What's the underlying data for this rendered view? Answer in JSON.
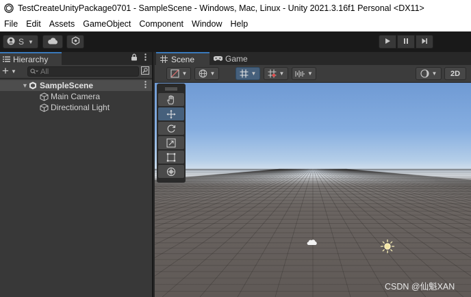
{
  "window": {
    "title": "TestCreateUnityPackage0701 - SampleScene - Windows, Mac, Linux - Unity 2021.3.16f1 Personal <DX11>"
  },
  "menu": {
    "items": [
      "File",
      "Edit",
      "Assets",
      "GameObject",
      "Component",
      "Window",
      "Help"
    ]
  },
  "toolbar": {
    "account_label": "S"
  },
  "hierarchy": {
    "tab_label": "Hierarchy",
    "search_placeholder": "All",
    "add_label": "+",
    "scene_name": "SampleScene",
    "items": [
      {
        "label": "Main Camera"
      },
      {
        "label": "Directional Light"
      }
    ]
  },
  "scene_view": {
    "tabs": [
      {
        "label": "Scene",
        "icon": "grid-icon",
        "active": true
      },
      {
        "label": "Game",
        "icon": "gamepad-icon",
        "active": false
      }
    ],
    "mode_2d_label": "2D",
    "sky_color": "#86aee0",
    "ground_color": "#625c59",
    "accent_color": "#3a79bb"
  },
  "watermark": "CSDN @仙魁XAN"
}
